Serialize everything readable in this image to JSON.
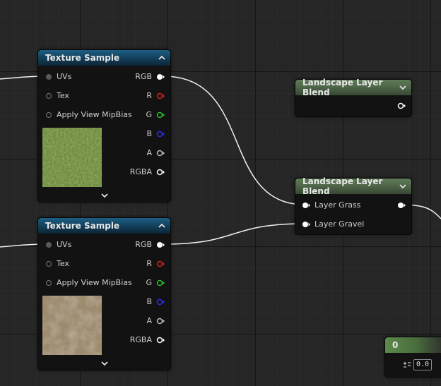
{
  "nodes": {
    "texture_sample_1": {
      "title": "Texture Sample",
      "inputs": [
        "UVs",
        "Tex",
        "Apply View MipBias"
      ],
      "outputs": [
        "RGB",
        "R",
        "G",
        "B",
        "A",
        "RGBA"
      ]
    },
    "texture_sample_2": {
      "title": "Texture Sample",
      "inputs": [
        "UVs",
        "Tex",
        "Apply View MipBias"
      ],
      "outputs": [
        "RGB",
        "R",
        "G",
        "B",
        "A",
        "RGBA"
      ]
    },
    "layer_blend_1": {
      "title": "Landscape Layer Blend"
    },
    "layer_blend_2": {
      "title": "Landscape Layer Blend",
      "inputs": [
        "Layer Grass",
        "Layer Gravel"
      ]
    },
    "constant": {
      "title": "0",
      "value": "0.0"
    }
  },
  "colors": {
    "pin_white": "#ffffff",
    "pin_r": "#e01b1b",
    "pin_g": "#27c227",
    "pin_b": "#2b2bff",
    "pin_a": "#bdbdbd",
    "wire": "#f0f0f0",
    "texture_header": "#1d5f86",
    "blend_header": "#5f7c58",
    "constant_header": "#5c8a4a"
  }
}
